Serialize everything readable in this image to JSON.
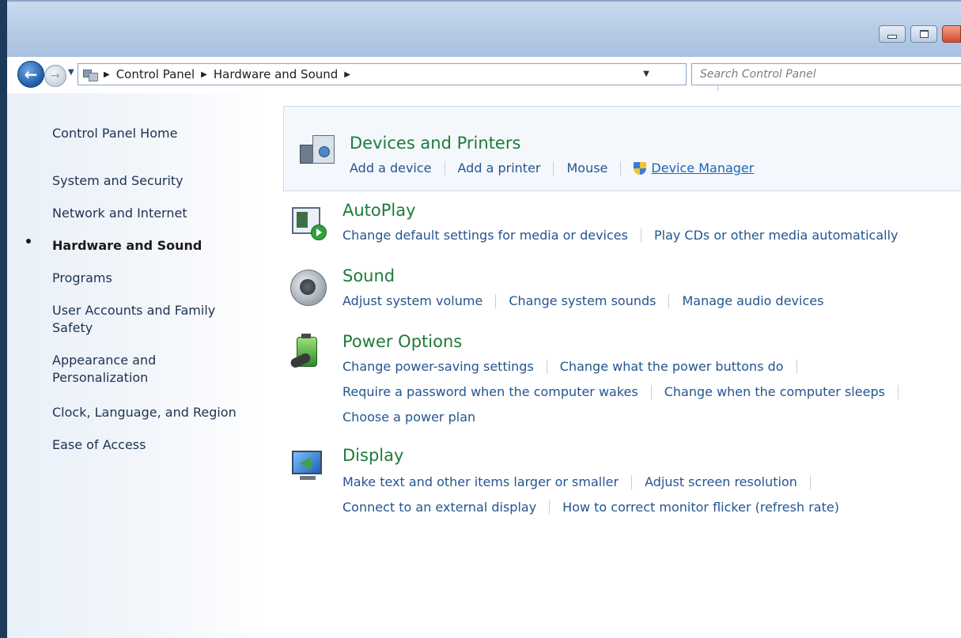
{
  "window": {
    "title_visible": "",
    "caption_buttons": [
      "minimize",
      "maximize",
      "close"
    ]
  },
  "navbar": {
    "breadcrumb": [
      "Control Panel",
      "Hardware and Sound"
    ],
    "search_placeholder": "Search Control Panel"
  },
  "sidebar": {
    "items": [
      {
        "label": "Control Panel Home"
      },
      {
        "label": "System and Security"
      },
      {
        "label": "Network and Internet"
      },
      {
        "label": "Hardware and Sound",
        "current": true
      },
      {
        "label": "Programs"
      },
      {
        "label": "User Accounts and Family Safety"
      },
      {
        "label": "Appearance and Personalization"
      },
      {
        "label": "Clock, Language, and Region"
      },
      {
        "label": "Ease of Access"
      }
    ]
  },
  "sections": {
    "devices": {
      "title": "Devices and Printers",
      "tasks": [
        "Add a device",
        "Add a printer",
        "Mouse",
        "Device Manager"
      ],
      "icon": "printer-icon"
    },
    "autoplay": {
      "title": "AutoPlay",
      "tasks": [
        "Change default settings for media or devices",
        "Play CDs or other media automatically"
      ],
      "icon": "autoplay-icon"
    },
    "sound": {
      "title": "Sound",
      "tasks": [
        "Adjust system volume",
        "Change system sounds",
        "Manage audio devices"
      ],
      "icon": "speaker-icon"
    },
    "power": {
      "title": "Power Options",
      "tasks_row1": [
        "Change power-saving settings",
        "Change what the power buttons do"
      ],
      "tasks_row2": [
        "Require a password when the computer wakes",
        "Change when the computer sleeps"
      ],
      "tasks_row3": [
        "Choose a power plan"
      ],
      "icon": "battery-icon"
    },
    "display": {
      "title": "Display",
      "tasks_row1": [
        "Make text and other items larger or smaller",
        "Adjust screen resolution"
      ],
      "tasks_row2": [
        "Connect to an external display",
        "How to correct monitor flicker (refresh rate)"
      ],
      "icon": "monitor-icon"
    }
  },
  "colors": {
    "section_title": "#1e7b3a",
    "task_link": "#24558f",
    "sidebar_bg": "#e9f0f8",
    "titlebar": "#b8cde6"
  }
}
